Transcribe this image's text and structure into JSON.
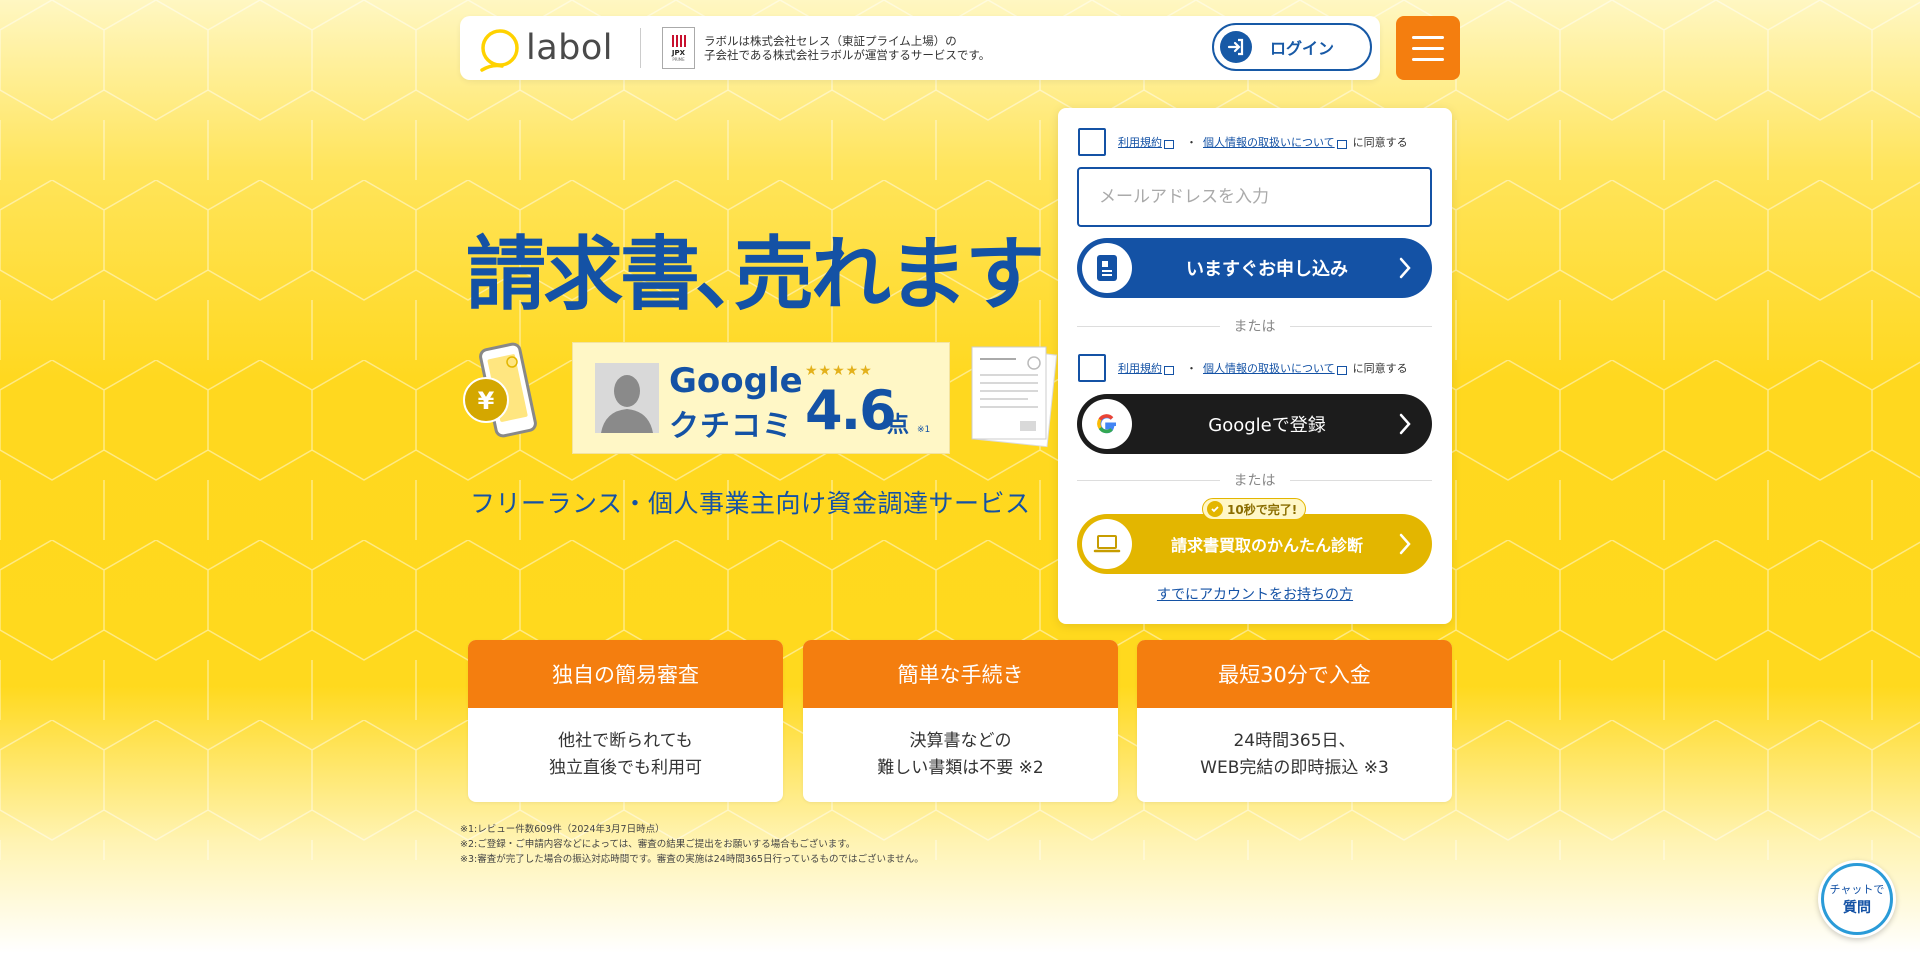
{
  "header": {
    "logo_text": "labol",
    "jpx_label": "JPX",
    "jpx_sub": "PRIME",
    "note_line1": "ラボルは株式会社セレス（東証プライム上場）の",
    "note_line2": "子会社である株式会社ラボルが運営するサービスです。",
    "login_label": "ログイン",
    "menu_icon": "hamburger-menu-icon"
  },
  "hero": {
    "headline": "請求書､売れます",
    "review": {
      "google": "Google",
      "kuchikomi": "クチコミ",
      "stars": "★★★★★",
      "rating": 4.6,
      "score": "4.6",
      "unit": "点",
      "note": "※1"
    },
    "subheading": "フリーランス・個人事業主向け資金調達サービス"
  },
  "form": {
    "terms_link": "利用規約",
    "privacy_link": "個人情報の取扱いについて",
    "dot": "・",
    "agree_suffix": "に同意する",
    "email_placeholder": "メールアドレスを入力",
    "apply_label": "いますぐお申し込み",
    "or_label": "または",
    "google_label": "Googleで登録",
    "badge_label": "10秒で完了!",
    "diagnosis_label": "請求書買取のかんたん診断",
    "account_link": "すでにアカウントをお持ちの方"
  },
  "features": [
    {
      "title": "独自の簡易審査",
      "line1": "他社で断られても",
      "line2": "独立直後でも利用可"
    },
    {
      "title": "簡単な手続き",
      "line1": "決算書などの",
      "line2": "難しい書類は不要 ※2"
    },
    {
      "title": "最短30分で入金",
      "line1": "24時間365日、",
      "line2": "WEB完結の即時振込 ※3"
    }
  ],
  "footnotes": [
    "※1:レビュー件数609件（2024年3月7日時点）",
    "※2:ご登録・ご申請内容などによっては、審査の結果ご提出をお願いする場合もございます。",
    "※3:審査が完了した場合の振込対応時間です。審査の実施は24時間365日行っているものではございません。"
  ],
  "chat": {
    "line1": "チャットで",
    "line2": "質問"
  },
  "colors": {
    "brand_blue": "#1452a5",
    "accent_orange": "#f47e0f",
    "accent_yellow": "#e3b600",
    "google_dark": "#1c1c1c"
  }
}
